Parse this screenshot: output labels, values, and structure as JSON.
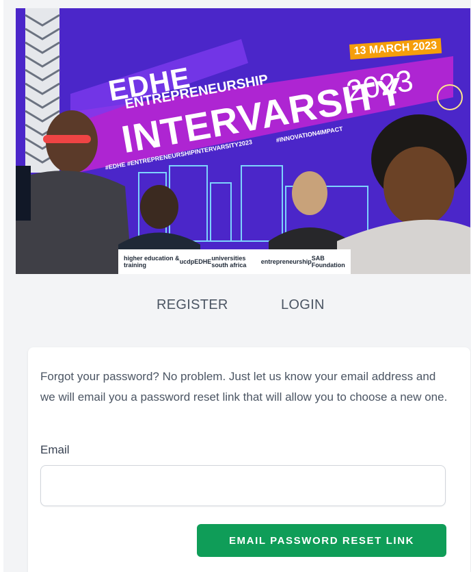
{
  "banner": {
    "title_line1": "EDHE",
    "title_line2": "ENTREPRENEURSHIP",
    "title_line3": "INTERVARSITY",
    "year": "2023",
    "date": "13 MARCH 2023",
    "hashtag_left": "#EDHE  #ENTREPRENEURSHIPINTERVARSITY2023",
    "hashtag_right": "#INNOVATION4IMPACT",
    "sponsors": [
      "higher education & training",
      "ucdp",
      "EDHE",
      "universities south africa",
      "entrepreneurship",
      "SAB Foundation"
    ],
    "colors": {
      "background": "#4b26c9",
      "pink_band": "#c026d3",
      "accent": "#f59e0b"
    }
  },
  "nav": {
    "register": "REGISTER",
    "login": "LOGIN"
  },
  "form": {
    "intro": "Forgot your password? No problem. Just let us know your email address and we will email you a password reset link that will allow you to choose a new one.",
    "email_label": "Email",
    "email_value": "",
    "submit_label": "EMAIL PASSWORD RESET LINK",
    "submit_color": "#0f9d58"
  }
}
